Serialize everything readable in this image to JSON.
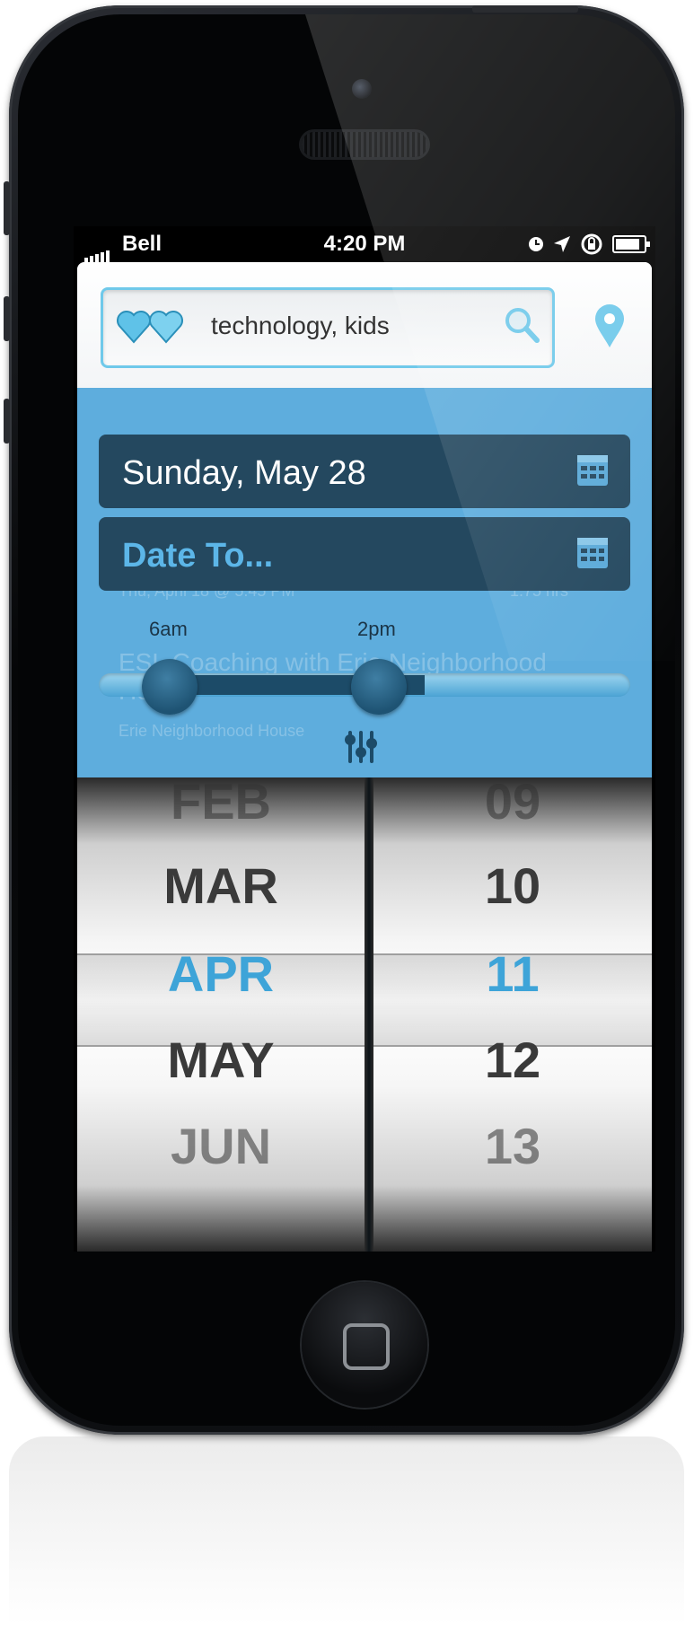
{
  "status_bar": {
    "carrier": "Bell",
    "time": "4:20 PM"
  },
  "search": {
    "query": "technology, kids"
  },
  "filter": {
    "date_from": "Sunday, May 28",
    "date_to": "Date To...",
    "time_range": {
      "start_label": "6am",
      "end_label": "2pm"
    }
  },
  "background_list": {
    "subtitle": "Thu, April 18 @ 5:45 PM",
    "duration": "1.75 hrs",
    "title": "ESL Coaching with Erie Neighborhood House",
    "organization": "Erie Neighborhood House"
  },
  "picker": {
    "months": [
      "FEB",
      "MAR",
      "APR",
      "MAY",
      "JUN"
    ],
    "days": [
      "09",
      "10",
      "11",
      "12",
      "13"
    ],
    "selected_month": "APR",
    "selected_day": "11"
  },
  "colors": {
    "accent": "#6fc9ea",
    "selected": "#3ea4d8",
    "dark_button": "#24485f",
    "panel": "#57aadc"
  }
}
